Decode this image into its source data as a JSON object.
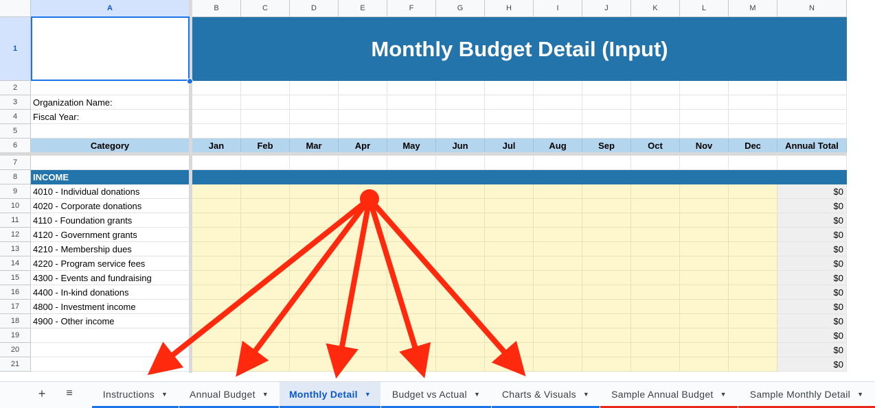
{
  "columns": [
    "A",
    "B",
    "C",
    "D",
    "E",
    "F",
    "G",
    "H",
    "I",
    "J",
    "K",
    "L",
    "M",
    "N"
  ],
  "rows": [
    "1",
    "2",
    "3",
    "4",
    "5",
    "6",
    "7",
    "8",
    "9",
    "10",
    "11",
    "12",
    "13",
    "14",
    "15",
    "16",
    "17",
    "18",
    "19",
    "20",
    "21"
  ],
  "title": "Monthly Budget Detail (Input)",
  "org_label": "Organization Name:",
  "fiscal_label": "Fiscal Year:",
  "header": {
    "category": "Category",
    "months": [
      "Jan",
      "Feb",
      "Mar",
      "Apr",
      "May",
      "Jun",
      "Jul",
      "Aug",
      "Sep",
      "Oct",
      "Nov",
      "Dec"
    ],
    "total": "Annual Total"
  },
  "section": "INCOME",
  "income_items": [
    "4010 - Individual donations",
    "4020 - Corporate donations",
    "4110 - Foundation grants",
    "4120 - Government grants",
    "4210 - Membership dues",
    "4220 - Program service fees",
    "4300 - Events and fundraising",
    "4400 - In-kind donations",
    "4800 - Investment income",
    "4900 - Other income",
    "",
    "",
    ""
  ],
  "totals": [
    "$0",
    "$0",
    "$0",
    "$0",
    "$0",
    "$0",
    "$0",
    "$0",
    "$0",
    "$0",
    "$0",
    "$0",
    "$0"
  ],
  "tabs": [
    {
      "label": "Instructions",
      "underline": "#1a73e8"
    },
    {
      "label": "Annual Budget",
      "underline": "#1a73e8"
    },
    {
      "label": "Monthly Detail",
      "underline": "#1a73e8"
    },
    {
      "label": "Budget vs Actual",
      "underline": "#1a73e8"
    },
    {
      "label": "Charts & Visuals",
      "underline": "#1a73e8"
    },
    {
      "label": "Sample Annual Budget",
      "underline": "#e8291c"
    },
    {
      "label": "Sample Monthly Detail",
      "underline": "#e8291c"
    }
  ],
  "add_sheet_symbol": "+",
  "all_sheets_symbol": "≡",
  "caret": "▼",
  "colors": {
    "title_band": "#2474ac",
    "header_row": "#b4d5ee",
    "input_cells": "#fef7cd",
    "total_cells": "#efefef",
    "arrow": "#ff2a0e",
    "active_tab": "#0b57d0"
  },
  "annotation": {
    "type": "arrows",
    "icon": "red-arrow-icon",
    "count": 5
  }
}
